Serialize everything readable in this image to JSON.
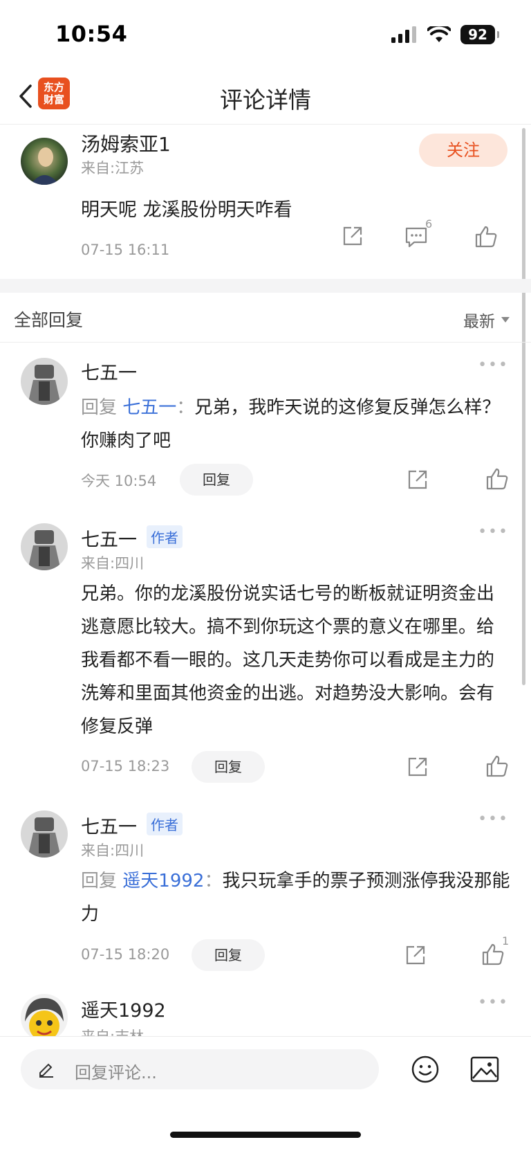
{
  "status": {
    "time": "10:54",
    "battery": "92"
  },
  "nav": {
    "title": "评论详情",
    "logo_line1": "东方",
    "logo_line2": "财富"
  },
  "post": {
    "username": "汤姆索亚1",
    "from": "来自:江苏",
    "follow_label": "关注",
    "text": "明天呢 龙溪股份明天咋看",
    "time": "07-15 16:11",
    "comment_count": "6"
  },
  "replies_header": {
    "label": "全部回复",
    "sort": "最新"
  },
  "replies": [
    {
      "name": "七五一",
      "reply_word": "回复",
      "mention": "七五一",
      "colon": "：",
      "text": "兄弟，我昨天说的这修复反弹怎么样？你赚肉了吧",
      "time": "今天 10:54",
      "reply_label": "回复"
    },
    {
      "name": "七五一",
      "tag": "作者",
      "from": "来自:四川",
      "text": "兄弟。你的龙溪股份说实话七号的断板就证明资金出逃意愿比较大。搞不到你玩这个票的意义在哪里。给我看都不看一眼的。这几天走势你可以看成是主力的洗筹和里面其他资金的出逃。对趋势没大影响。会有修复反弹",
      "time": "07-15 18:23",
      "reply_label": "回复"
    },
    {
      "name": "七五一",
      "tag": "作者",
      "from": "来自:四川",
      "reply_word": "回复",
      "mention": "遥天1992",
      "colon": "：",
      "text": "我只玩拿手的票子预测涨停我没那能力",
      "time": "07-15 18:20",
      "reply_label": "回复",
      "like_count": "1"
    },
    {
      "name": "遥天1992",
      "from": "来自:吉林"
    }
  ],
  "bottom": {
    "placeholder": "回复评论..."
  },
  "colors": {
    "brand": "#e8501f",
    "link": "#3a6fd8",
    "muted": "#999999"
  }
}
